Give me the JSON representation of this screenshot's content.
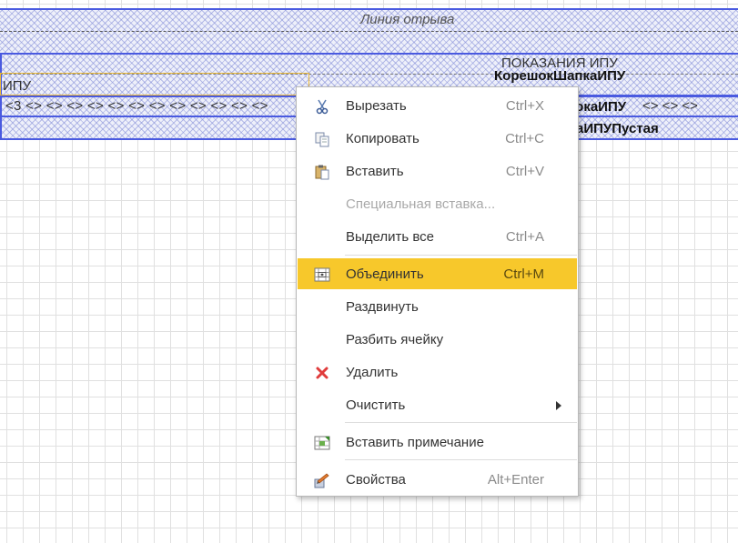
{
  "sheet": {
    "tear_line": "Линия отрыва",
    "header_title": "ПОКАЗАНИЯ ИПУ",
    "header_section": "КорешокШапкаИПУ",
    "cell_ipu": "ИПУ",
    "row_cells": "<3 <> <> <> <> <> <> <> <> <> <> <> <>",
    "row_name": "рокаИПУ",
    "row_right_cells": "<> <> <>",
    "empty_row_name": "аИПУПустая"
  },
  "context_menu": {
    "items": [
      {
        "label": "Вырезать",
        "shortcut": "Ctrl+X",
        "icon": "scissors-icon"
      },
      {
        "label": "Копировать",
        "shortcut": "Ctrl+C",
        "icon": "copy-icon"
      },
      {
        "label": "Вставить",
        "shortcut": "Ctrl+V",
        "icon": "paste-icon"
      },
      {
        "label": "Специальная вставка...",
        "shortcut": "",
        "icon": "",
        "disabled": true
      },
      {
        "label": "Выделить все",
        "shortcut": "Ctrl+A",
        "icon": ""
      },
      {
        "label": "Объединить",
        "shortcut": "Ctrl+M",
        "icon": "merge-cells-icon",
        "highlighted": true
      },
      {
        "label": "Раздвинуть",
        "shortcut": "",
        "icon": ""
      },
      {
        "label": "Разбить ячейку",
        "shortcut": "",
        "icon": ""
      },
      {
        "label": "Удалить",
        "shortcut": "",
        "icon": "delete-x-icon"
      },
      {
        "label": "Очистить",
        "shortcut": "",
        "icon": "",
        "submenu": true
      },
      {
        "label": "Вставить примечание",
        "shortcut": "",
        "icon": "insert-note-icon"
      },
      {
        "label": "Свойства",
        "shortcut": "Alt+Enter",
        "icon": "properties-icon"
      }
    ]
  },
  "colors": {
    "highlight": "#f7c82b",
    "band_border": "#4a5ae0",
    "delete_icon": "#e03c3c"
  }
}
